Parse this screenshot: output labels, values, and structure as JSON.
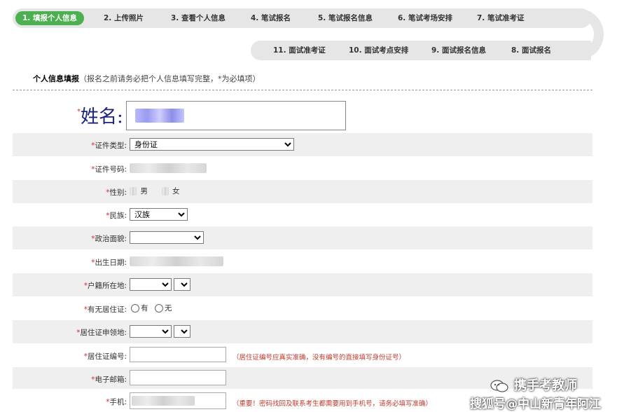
{
  "steps_row1": [
    {
      "label": "1. 填报个人信息",
      "active": true
    },
    {
      "label": "2. 上传照片"
    },
    {
      "label": "3. 查看个人信息"
    },
    {
      "label": "4. 笔试报名"
    },
    {
      "label": "5. 笔试报名信息"
    },
    {
      "label": "6. 笔试考场安排"
    },
    {
      "label": "7. 笔试准考证"
    }
  ],
  "steps_row2": [
    {
      "label": "11. 面试准考证"
    },
    {
      "label": "10. 面试考点安排"
    },
    {
      "label": "9. 面试报名信息"
    },
    {
      "label": "8. 面试报名"
    }
  ],
  "section": {
    "title": "个人信息填报",
    "note": "（报名之前请务必把个人信息填写完整，*为必填项）"
  },
  "required_mark": "*",
  "form": {
    "name_label": "姓名:",
    "id_type_label": "证件类型:",
    "id_type_value": "身份证",
    "id_number_label": "证件号码:",
    "gender_label": "性别:",
    "gender_male": "男",
    "gender_female": "女",
    "ethnicity_label": "民族:",
    "ethnicity_value": "汉族",
    "political_label": "政治面貌:",
    "political_value": "",
    "birthdate_label": "出生日期:",
    "hukou_label": "户籍所在地:",
    "has_permit_label": "有无居住证:",
    "has_permit_yes": "有",
    "has_permit_no": "无",
    "permit_place_label": "居住证申领地:",
    "permit_number_label": "居住证编号:",
    "permit_number_hint": "（居住证编号应真实准确，没有编号的直接填写身份证号）",
    "email_label": "电子邮箱:",
    "phone_label": "手机:",
    "phone_hint": "（重要！密码找回及联系考生都需要用到手机号，请务必填写准确）"
  },
  "watermark": {
    "line1": "携手考教师",
    "line2": "搜狐号@中山新青年阿江"
  }
}
